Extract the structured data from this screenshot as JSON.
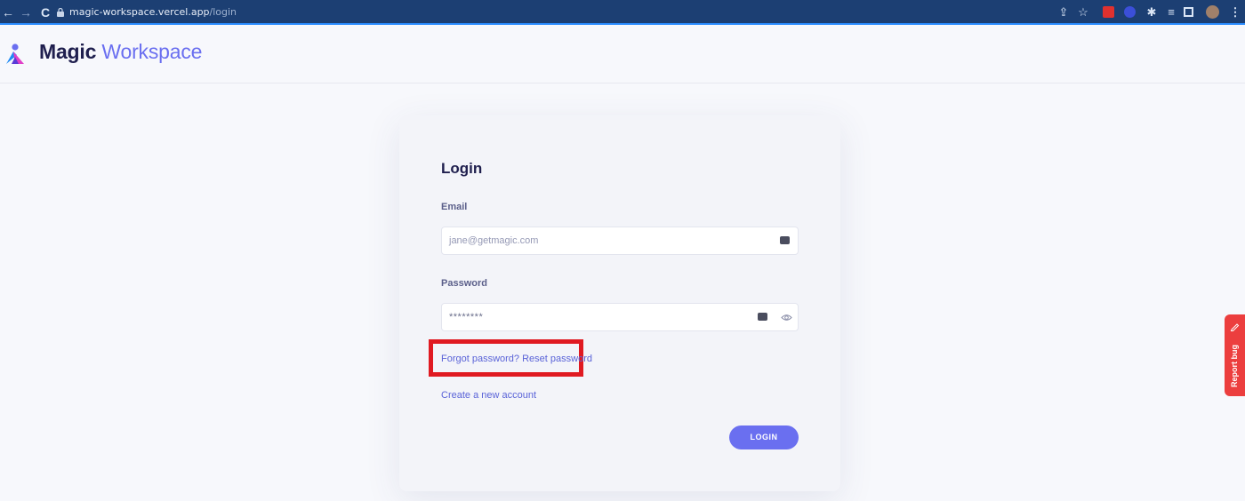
{
  "browser": {
    "url_host": "magic-workspace.vercel.app",
    "url_path": "/login",
    "colors": {
      "chrome": "#1c3f73",
      "accent": "#2a8cff"
    }
  },
  "header": {
    "brand_first": "Magic",
    "brand_second": "Workspace",
    "logo_icon": "people-logo-icon"
  },
  "login": {
    "title": "Login",
    "email_label": "Email",
    "email_placeholder": "jane@getmagic.com",
    "password_label": "Password",
    "password_value": "********",
    "forgot_text": "Forgot password? Reset password",
    "create_text": "Create a new account",
    "button_label": "LOGIN"
  },
  "report_bug": {
    "label": "Report bug",
    "color": "#ec3e3e"
  },
  "theme": {
    "primary": "#6a6ff0",
    "highlight": "#e01a22"
  }
}
